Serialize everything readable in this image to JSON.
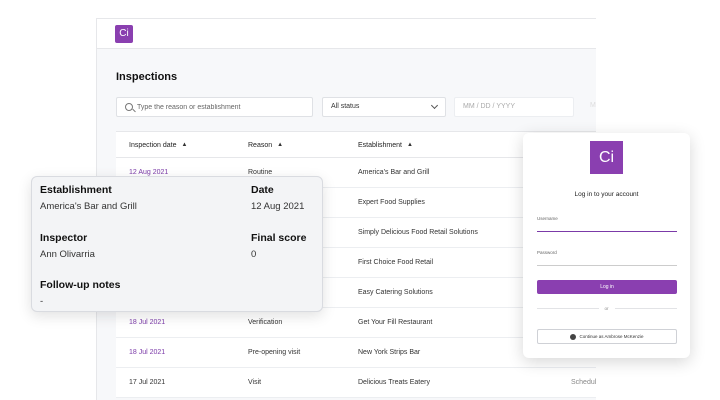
{
  "app": {
    "logo_text": "Ci",
    "page_title": "Inspections"
  },
  "filters": {
    "search_placeholder": "Type the reason or establishment",
    "status_value": "All status",
    "date_placeholder": "MM / DD / YYYY",
    "date_placeholder_2": "MM / DD / YYYY"
  },
  "table": {
    "columns": [
      "Inspection date",
      "Reason",
      "Establishment"
    ],
    "rows": [
      {
        "date": "12 Aug 2021",
        "reason": "Routine",
        "establishment": "America's Bar and Grill",
        "status": ""
      },
      {
        "date": "",
        "reason": "",
        "establishment": "Expert Food Supplies",
        "status": ""
      },
      {
        "date": "",
        "reason": "",
        "establishment": "Simply Delicious Food Retail Solutions",
        "status": ""
      },
      {
        "date": "",
        "reason": "",
        "establishment": "First Choice Food Retail",
        "status": ""
      },
      {
        "date": "",
        "reason": "",
        "establishment": "Easy Catering Solutions",
        "status": ""
      },
      {
        "date": "18 Jul 2021",
        "reason": "Verification",
        "establishment": "Get Your Fill Restaurant",
        "status": ""
      },
      {
        "date": "18 Jul 2021",
        "reason": "Pre-opening visit",
        "establishment": "New York Strips Bar",
        "status": ""
      },
      {
        "date": "17 Jul 2021",
        "reason": "Visit",
        "establishment": "Delicious Treats Eatery",
        "status": "Scheduled"
      }
    ]
  },
  "detail": {
    "establishment_label": "Establishment",
    "establishment_value": "America's Bar and Grill",
    "date_label": "Date",
    "date_value": "12 Aug 2021",
    "inspector_label": "Inspector",
    "inspector_value": "Ann Olivarria",
    "score_label": "Final score",
    "score_value": "0",
    "notes_label": "Follow-up notes",
    "notes_value": "-"
  },
  "login": {
    "logo_text": "Ci",
    "title": "Log in to your account",
    "username_label": "Username",
    "password_label": "Password",
    "login_button": "Log in",
    "or_text": "or",
    "sso_button": "Continue as Ambrose McKenzie"
  },
  "colors": {
    "accent": "#8a3fb0",
    "date_link": "#7b3aa8"
  }
}
